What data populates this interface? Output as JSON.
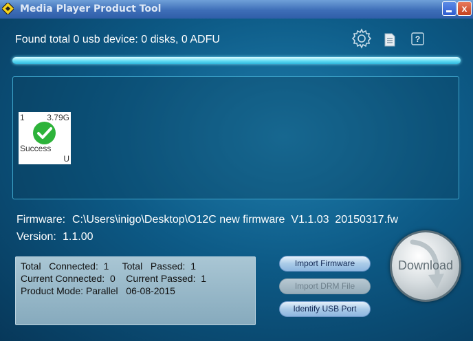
{
  "window": {
    "title": "Media Player Product Tool",
    "close_glyph": "x"
  },
  "icons": {
    "app": "app-logo-icon",
    "settings": "gear-icon",
    "log": "document-icon",
    "help": "help-icon",
    "check": "check-icon",
    "download_arrow": "curved-arrow-icon"
  },
  "status": {
    "device_summary": "Found total 0 usb device: 0 disks, 0 ADFU",
    "help_glyph": "?"
  },
  "progress": {
    "value": 1.0
  },
  "devices": [
    {
      "index": "1",
      "size": "3.79G",
      "status": "Success",
      "type": "U"
    }
  ],
  "firmware": {
    "label": "Firmware:",
    "path": "C:\\Users\\inigo\\Desktop\\O12C new firmware  V1.1.03  20150317.fw",
    "version_label": "Version:",
    "version": "1.1.00"
  },
  "stats": {
    "line1": "Total   Connected:  1     Total   Passed:  1",
    "line2": "Current Connected:  0    Current Passed:  1",
    "line3": "Product Mode: Parallel   06-08-2015"
  },
  "buttons": {
    "import_firmware": "Import Firmware",
    "import_drm": "Import DRM File",
    "identify_usb": "Identify USB Port",
    "download": "Download"
  },
  "colors": {
    "success_green": "#2db33a",
    "progress_cyan": "#5ed9f2"
  }
}
